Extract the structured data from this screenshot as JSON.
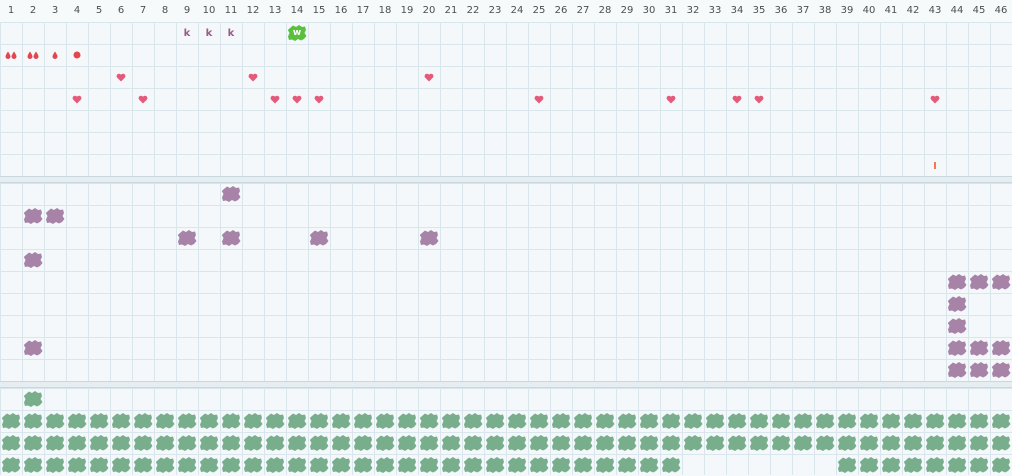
{
  "board": {
    "columns": [
      "1",
      "2",
      "3",
      "4",
      "5",
      "6",
      "7",
      "8",
      "9",
      "10",
      "11",
      "12",
      "13",
      "14",
      "15",
      "16",
      "17",
      "18",
      "19",
      "20",
      "21",
      "22",
      "23",
      "24",
      "25",
      "26",
      "27",
      "28",
      "29",
      "30",
      "31",
      "32",
      "33",
      "34",
      "35",
      "36",
      "37",
      "38",
      "39",
      "40",
      "41",
      "42",
      "43",
      "44",
      "45",
      "46"
    ]
  },
  "colors": {
    "heart": "#e35a7a",
    "drop": "#e0474f",
    "letter_k": "#9b5a87",
    "w_blob": "#59c03d",
    "purple_blob": "#a783a8",
    "green_blob": "#79ae8d",
    "bar": "#f07a52"
  },
  "top_items": [
    {
      "type": "glyph",
      "text": "k",
      "col": 9,
      "row": 0
    },
    {
      "type": "glyph",
      "text": "k",
      "col": 10,
      "row": 0
    },
    {
      "type": "glyph",
      "text": "k",
      "col": 11,
      "row": 0
    },
    {
      "type": "w",
      "text": "w",
      "col": 14,
      "row": 0
    },
    {
      "type": "drop2",
      "col": 1,
      "row": 1
    },
    {
      "type": "drop2",
      "col": 2,
      "row": 1
    },
    {
      "type": "drop1",
      "col": 3,
      "row": 1
    },
    {
      "type": "dot",
      "col": 4,
      "row": 1
    },
    {
      "type": "heart",
      "col": 6,
      "row": 2
    },
    {
      "type": "heart",
      "col": 12,
      "row": 2
    },
    {
      "type": "heart",
      "col": 20,
      "row": 2
    },
    {
      "type": "heart",
      "col": 4,
      "row": 3
    },
    {
      "type": "heart",
      "col": 7,
      "row": 3
    },
    {
      "type": "heart",
      "col": 13,
      "row": 3
    },
    {
      "type": "heart",
      "col": 14,
      "row": 3
    },
    {
      "type": "heart",
      "col": 15,
      "row": 3
    },
    {
      "type": "heart",
      "col": 25,
      "row": 3
    },
    {
      "type": "heart",
      "col": 31,
      "row": 3
    },
    {
      "type": "heart",
      "col": 34,
      "row": 3
    },
    {
      "type": "heart",
      "col": 35,
      "row": 3
    },
    {
      "type": "heart",
      "col": 43,
      "row": 3
    },
    {
      "type": "bar",
      "col": 43,
      "row": 6
    }
  ],
  "purple_cells": [
    [
      11,
      0
    ],
    [
      2,
      1
    ],
    [
      3,
      1
    ],
    [
      9,
      2
    ],
    [
      11,
      2
    ],
    [
      15,
      2
    ],
    [
      20,
      2
    ],
    [
      2,
      3
    ],
    [
      44,
      4
    ],
    [
      45,
      4
    ],
    [
      46,
      4
    ],
    [
      44,
      5
    ],
    [
      44,
      6
    ],
    [
      2,
      7
    ],
    [
      44,
      7
    ],
    [
      45,
      7
    ],
    [
      46,
      7
    ],
    [
      44,
      8
    ],
    [
      45,
      8
    ],
    [
      46,
      8
    ]
  ],
  "green_layout": {
    "row0_cols": [
      2
    ],
    "row1_from": 1,
    "row1_to": 46,
    "row2_from": 1,
    "row2_to": 46,
    "row3_segments": [
      [
        1,
        31
      ],
      [
        39,
        46
      ]
    ]
  }
}
